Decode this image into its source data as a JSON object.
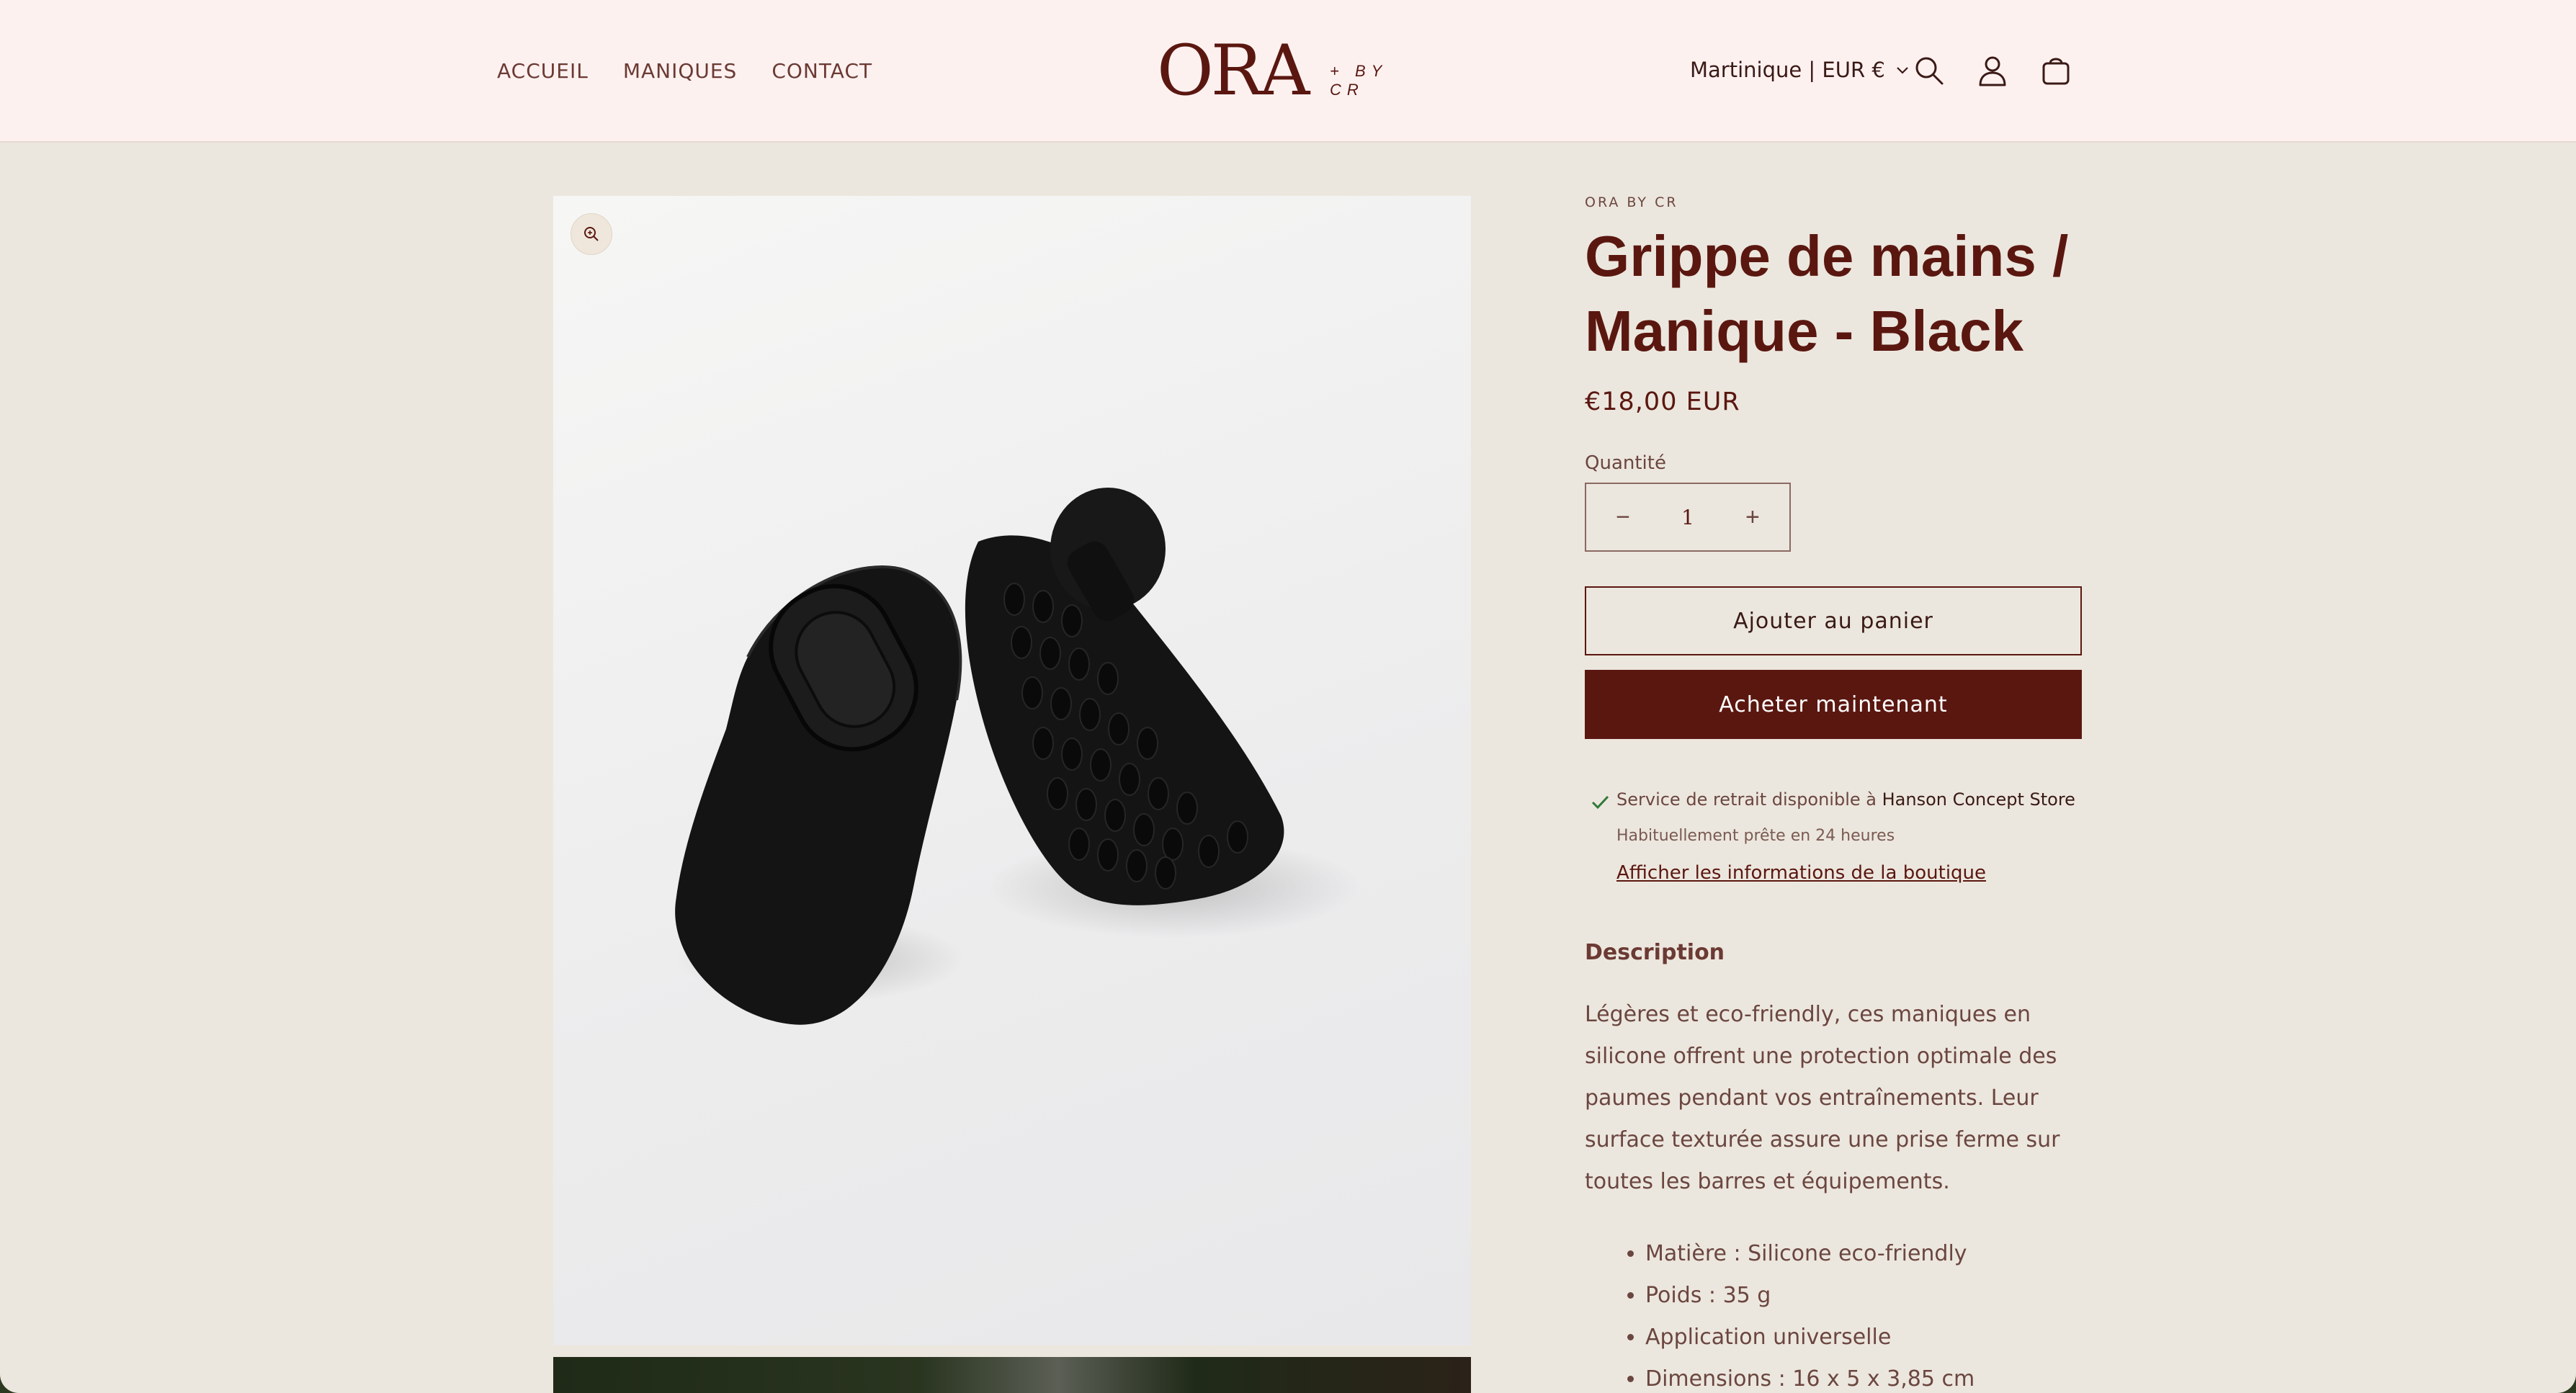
{
  "nav": {
    "items": [
      "ACCUEIL",
      "MANIQUES",
      "CONTACT"
    ]
  },
  "logo": {
    "main": "ORA",
    "sub": "+ BY CR"
  },
  "header": {
    "locale": "Martinique | EUR €",
    "icons": [
      "search-icon",
      "account-icon",
      "cart-icon"
    ]
  },
  "product": {
    "vendor": "ORA BY CR",
    "title": "Grippe de mains / Manique - Black",
    "price": "€18,00 EUR",
    "quantity_label": "Quantité",
    "quantity_value": "1",
    "minus": "−",
    "plus": "+",
    "add_to_cart": "Ajouter au panier",
    "buy_now": "Acheter maintenant"
  },
  "pickup": {
    "text": "Service de retrait disponible à",
    "store": "Hanson Concept Store",
    "sub": "Habituellement prête en 24 heures",
    "link": "Afficher les informations de la boutique"
  },
  "description": {
    "heading": "Description",
    "paragraph": "Légères et eco-friendly, ces maniques en silicone offrent une protection optimale des paumes pendant vos entraînements. Leur surface texturée assure une prise ferme sur toutes les barres et équipements.",
    "list": [
      "Matière : Silicone eco-friendly",
      "Poids : 35 g",
      "Application universelle",
      "Dimensions : 16 x 5 x 3,85 cm"
    ]
  },
  "colors": {
    "brand": "#5a1710",
    "header_bg": "#fdf1f0",
    "page_bg": "#ece7de"
  }
}
